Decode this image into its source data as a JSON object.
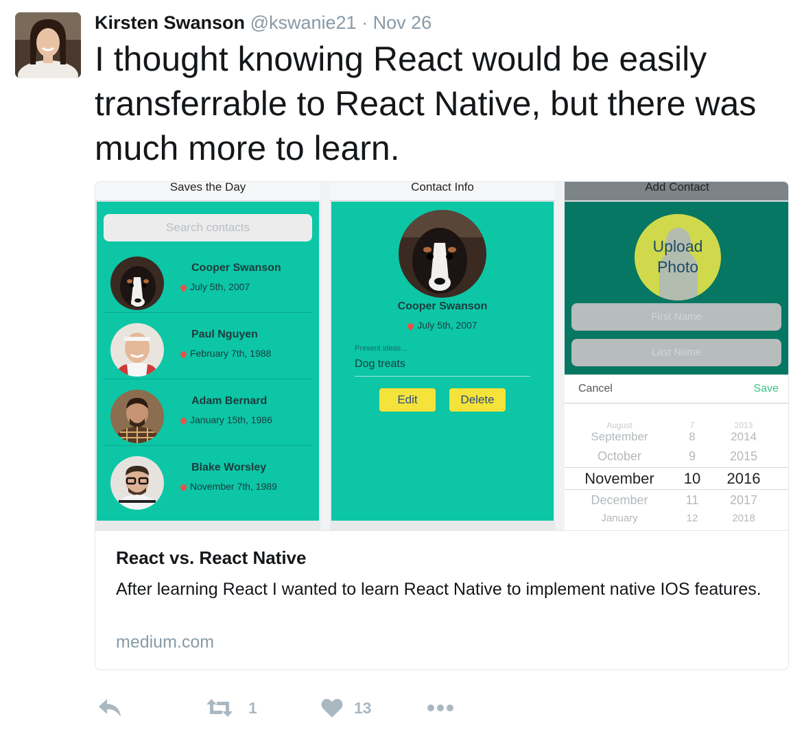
{
  "tweet": {
    "author_name": "Kirsten Swanson",
    "handle": "@kswanie21",
    "separator": "·",
    "date": "Nov 26",
    "text": "I thought knowing React would be easily transferrable to React Native, but there was much more to learn."
  },
  "card": {
    "title": "React vs. React Native",
    "description": "After learning React I wanted to learn React Native to implement native IOS features.",
    "domain": "medium.com",
    "screens": {
      "list": {
        "title": "Saves the Day",
        "search_placeholder": "Search contacts",
        "contacts": [
          {
            "name": "Cooper Swanson",
            "date": "July 5th, 2007"
          },
          {
            "name": "Paul Nguyen",
            "date": "February 7th, 1988"
          },
          {
            "name": "Adam Bernard",
            "date": "January 15th, 1986"
          },
          {
            "name": "Blake Worsley",
            "date": "November 7th, 1989"
          }
        ]
      },
      "detail": {
        "title": "Contact Info",
        "name": "Cooper Swanson",
        "date": "July 5th, 2007",
        "ideas_label": "Present ideas...",
        "ideas_value": "Dog treats",
        "edit_label": "Edit",
        "delete_label": "Delete"
      },
      "add": {
        "title": "Add Contact",
        "upload_line1": "Upload",
        "upload_line2": "Photo",
        "first_name_placeholder": "First Name",
        "last_name_placeholder": "Last Name",
        "cancel_label": "Cancel",
        "save_label": "Save",
        "months": [
          "August",
          "September",
          "October",
          "November",
          "December",
          "January"
        ],
        "days": [
          "7",
          "8",
          "9",
          "10",
          "11",
          "12"
        ],
        "years": [
          "2013",
          "2014",
          "2015",
          "2016",
          "2017",
          "2018"
        ]
      }
    }
  },
  "actions": {
    "reply_icon": "reply-icon",
    "retweet_icon": "retweet-icon",
    "retweet_count": "1",
    "like_icon": "heart-icon",
    "like_count": "13",
    "more_icon": "more-icon"
  },
  "colors": {
    "teal": "#0cc6a6",
    "dark_teal": "#067763",
    "button_yellow": "#f4e33a",
    "muted_gray": "#8899a6",
    "action_gray": "#aab8c2"
  }
}
